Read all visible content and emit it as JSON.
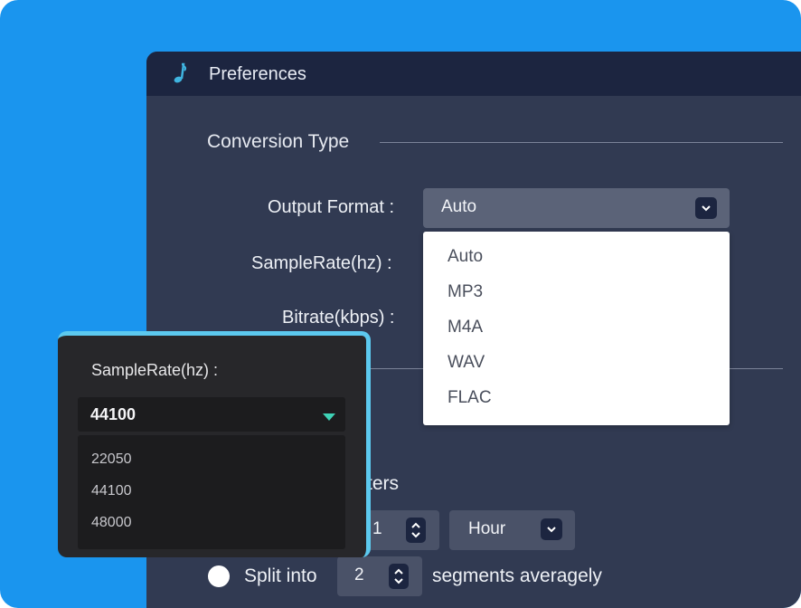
{
  "window": {
    "title": "Preferences",
    "app_icon": "music-note-icon"
  },
  "conversion": {
    "section_title": "Conversion Type",
    "output_format_label": "Output Format :",
    "output_format_value": "Auto",
    "samplerate_label": "SampleRate(hz) :",
    "bitrate_label": "Bitrate(kbps) :"
  },
  "format_dropdown": {
    "options": [
      "Auto",
      "MP3",
      "M4A",
      "WAV",
      "FLAC"
    ]
  },
  "split": {
    "partial_heading": "ters",
    "duration_value": "1",
    "unit_value": "Hour",
    "split_label": "Split into",
    "segments_value": "2",
    "segments_suffix": "segments averagely"
  },
  "samplerate_popup": {
    "label": "SampleRate(hz) :",
    "selected": "44100",
    "options": [
      "22050",
      "44100",
      "48000"
    ],
    "accent_color": "#5cc9ee",
    "caret_color": "#3fd2b6"
  },
  "colors": {
    "background_blue": "#1a95ee",
    "window_bg": "#313a52",
    "titlebar_bg": "#1c2540"
  }
}
